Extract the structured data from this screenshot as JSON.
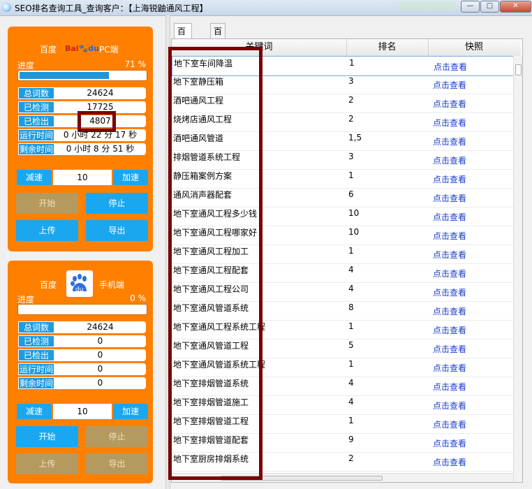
{
  "window": {
    "title": "SEO排名查询工具_查询客户：【上海锐鼬通风工程】",
    "minimize": "—",
    "maximize": "□",
    "close": "✕"
  },
  "pc_panel": {
    "label_left": "百度",
    "logo_text_red": "Bai",
    "logo_text_blue": "du",
    "label_right": "PC端",
    "progress_label": "进度",
    "progress_pct_text": "71 %",
    "progress_value": 0.71,
    "stats": [
      {
        "key": "总词数",
        "value": "24624"
      },
      {
        "key": "已检测",
        "value": "17725"
      },
      {
        "key": "已检出",
        "value": "4807"
      },
      {
        "key": "运行时间",
        "value": "0 小时 22 分 17 秒"
      },
      {
        "key": "剩余时间",
        "value": "0 小时 8 分 51 秒"
      }
    ],
    "slow_label": "减速",
    "speed": "10",
    "fast_label": "加速",
    "start_label": "开始",
    "stop_label": "停止",
    "upload_label": "上传",
    "export_label": "导出"
  },
  "mobile_panel": {
    "label_left": "百度",
    "icon_text": "du",
    "label_right": "手机端",
    "progress_label": "进度",
    "progress_pct_text": "0 %",
    "progress_value": 0,
    "stats": [
      {
        "key": "总词数",
        "value": "24624"
      },
      {
        "key": "已检测",
        "value": "0"
      },
      {
        "key": "已检出",
        "value": "0"
      },
      {
        "key": "运行时间",
        "value": "0"
      },
      {
        "key": "剩余时间",
        "value": "0"
      }
    ],
    "slow_label": "减速",
    "speed": "10",
    "fast_label": "加速",
    "start_label": "开始",
    "stop_label": "停止",
    "upload_label": "上传",
    "export_label": "导出"
  },
  "tabs": [
    {
      "label": "百度PC"
    },
    {
      "label": "百度手机"
    }
  ],
  "table": {
    "columns": [
      "关键词",
      "排名",
      "快照"
    ],
    "rows": [
      {
        "keyword": "地下室车间降温",
        "rank": "1",
        "link": "点击查看"
      },
      {
        "keyword": "地下室静压箱",
        "rank": "3",
        "link": "点击查看"
      },
      {
        "keyword": "酒吧通风工程",
        "rank": "2",
        "link": "点击查看"
      },
      {
        "keyword": "烧烤店通风工程",
        "rank": "2",
        "link": "点击查看"
      },
      {
        "keyword": "酒吧通风管道",
        "rank": "1,5",
        "link": "点击查看"
      },
      {
        "keyword": "排烟管道系统工程",
        "rank": "3",
        "link": "点击查看"
      },
      {
        "keyword": "静压箱案例方案",
        "rank": "1",
        "link": "点击查看"
      },
      {
        "keyword": "通风消声器配套",
        "rank": "6",
        "link": "点击查看"
      },
      {
        "keyword": "地下室通风工程多少钱",
        "rank": "10",
        "link": "点击查看"
      },
      {
        "keyword": "地下室通风工程哪家好",
        "rank": "10",
        "link": "点击查看"
      },
      {
        "keyword": "地下室通风工程加工",
        "rank": "1",
        "link": "点击查看"
      },
      {
        "keyword": "地下室通风工程配套",
        "rank": "4",
        "link": "点击查看"
      },
      {
        "keyword": "地下室通风工程公司",
        "rank": "4",
        "link": "点击查看"
      },
      {
        "keyword": "地下室通风管道系统",
        "rank": "8",
        "link": "点击查看"
      },
      {
        "keyword": "地下室通风工程系统工程",
        "rank": "1",
        "link": "点击查看"
      },
      {
        "keyword": "地下室通风管道工程",
        "rank": "5",
        "link": "点击查看"
      },
      {
        "keyword": "地下室通风管道系统工程",
        "rank": "1",
        "link": "点击查看"
      },
      {
        "keyword": "地下室排烟管道系统",
        "rank": "4",
        "link": "点击查看"
      },
      {
        "keyword": "地下室排烟管道施工",
        "rank": "4",
        "link": "点击查看"
      },
      {
        "keyword": "地下室排烟管道工程",
        "rank": "1",
        "link": "点击查看"
      },
      {
        "keyword": "地下室排烟管道配套",
        "rank": "9",
        "link": "点击查看"
      },
      {
        "keyword": "地下室厨房排烟系统",
        "rank": "2",
        "link": "点击查看"
      }
    ]
  },
  "colors": {
    "panel": "#ff8000",
    "accent_blue": "#1aa7f0",
    "disabled": "#b49a5f",
    "highlight_box": "#7a0000",
    "link": "#1a3cc8"
  }
}
